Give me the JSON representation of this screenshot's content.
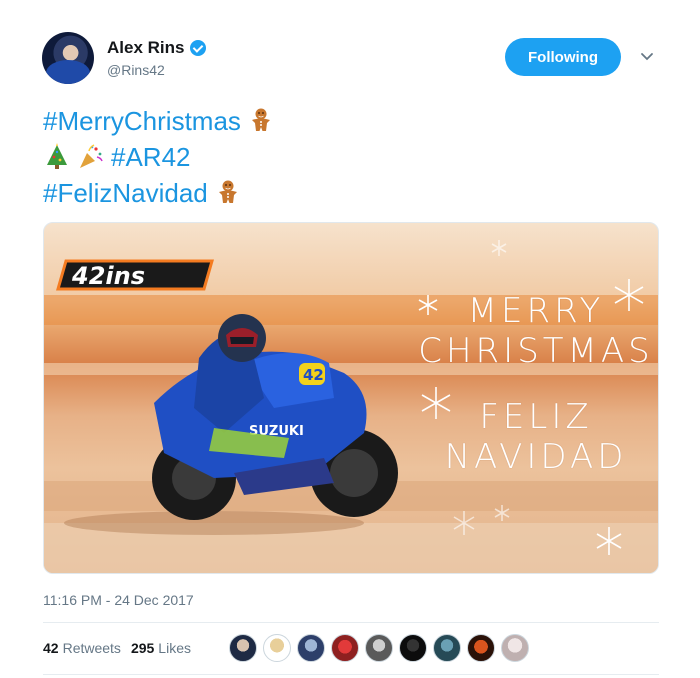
{
  "author": {
    "name": "Alex Rins",
    "handle": "@Rins42",
    "avatar_icon": "avatar"
  },
  "follow_button": {
    "label": "Following"
  },
  "tweet_text": {
    "lines": [
      {
        "hashtags": [
          "#MerryChristmas"
        ],
        "emojis_after": [
          "gingerbread-man"
        ]
      },
      {
        "emojis_before": [
          "christmas-tree",
          "party-popper"
        ],
        "hashtags": [
          "#AR42"
        ]
      },
      {
        "hashtags": [
          "#FelizNavidad"
        ],
        "emojis_after": [
          "gingerbread-man"
        ]
      }
    ]
  },
  "media": {
    "logo_text": "42ins",
    "line1": "MERRY",
    "line2": "CHRISTMAS",
    "line3": "FELIZ",
    "line4": "NAVIDAD",
    "bike_number": "42",
    "sponsor": "SUZUKI"
  },
  "timestamp": "11:16 PM - 24 Dec 2017",
  "stats": {
    "retweets_count": "42",
    "retweets_label": "Retweets",
    "likes_count": "295",
    "likes_label": "Likes"
  },
  "likers_count": 9,
  "colors": {
    "accent": "#1da1f2",
    "link": "#1b95e0",
    "muted": "#657786",
    "suzuki_blue": "#1f4fc4",
    "logo_orange": "#f47b20"
  }
}
